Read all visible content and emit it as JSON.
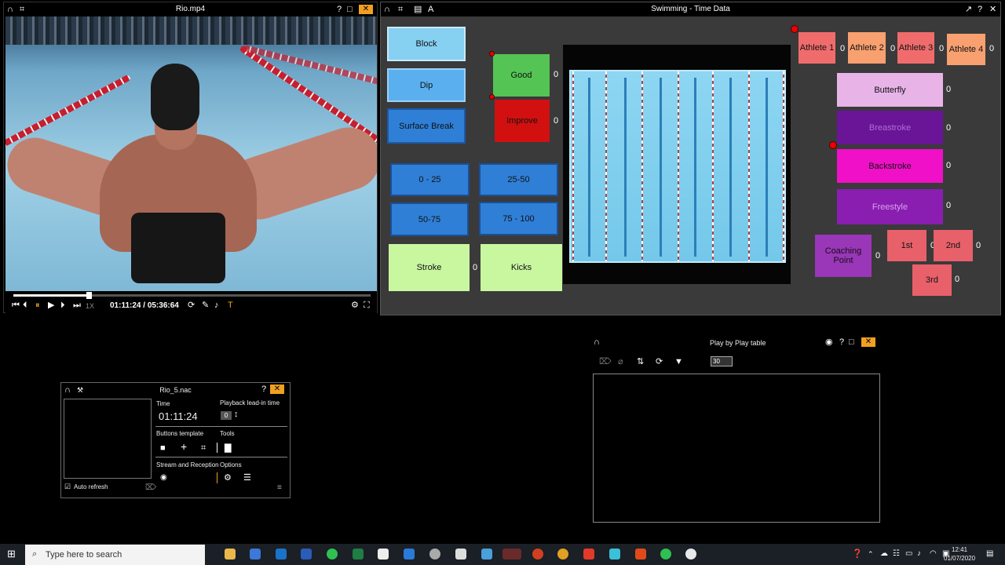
{
  "video_window": {
    "title": "Rio.mp4",
    "time_display": "01:11:24 / 05:36:64",
    "speed": "1X",
    "progress_fraction": 0.21
  },
  "timedata_window": {
    "title": "Swimming - Time Data",
    "start_buttons": [
      {
        "label": "Block",
        "color": "#86d0f2"
      },
      {
        "label": "Dip",
        "color": "#5aafef"
      },
      {
        "label": "Surface Break",
        "color": "#2f7fd6"
      }
    ],
    "quality": [
      {
        "label": "Good",
        "count": "0",
        "color": "#54c454"
      },
      {
        "label": "Improve",
        "count": "0",
        "color": "#d21010"
      }
    ],
    "splits": [
      "0 - 25",
      "25-50",
      "50-75",
      "75 - 100"
    ],
    "stroke": {
      "label": "Stroke",
      "count": "0",
      "color": "#c8f7a0"
    },
    "kicks": {
      "label": "Kicks",
      "color": "#c8f7a0"
    },
    "athletes": [
      {
        "label": "Athlete 1",
        "count": "0",
        "color": "#f06c6c"
      },
      {
        "label": "Athlete 2",
        "count": "0",
        "color": "#f8a070"
      },
      {
        "label": "Athlete 3",
        "count": "0",
        "color": "#f06c6c"
      },
      {
        "label": "Athlete 4",
        "count": "0",
        "color": "#f8a070"
      }
    ],
    "strokes": [
      {
        "label": "Butterfly",
        "count": "0",
        "color": "#e8b4e8"
      },
      {
        "label": "Breastroke",
        "count": "0",
        "color": "#6a1498"
      },
      {
        "label": "Backstroke",
        "count": "0",
        "color": "#f010c8"
      },
      {
        "label": "Freestyle",
        "count": "0",
        "color": "#8a1eb0"
      }
    ],
    "coaching": {
      "label": "Coaching Point",
      "count": "0",
      "color": "#9a36b8"
    },
    "places": [
      {
        "label": "1st",
        "count": "0"
      },
      {
        "label": "2nd",
        "count": "0"
      },
      {
        "label": "3rd",
        "count": "0"
      }
    ]
  },
  "nac_window": {
    "title": "Rio_5.nac",
    "time_label": "Time",
    "time_value": "01:11:24",
    "leadin_label": "Playback lead-in time",
    "leadin_value": "0",
    "buttons_template": "Buttons template",
    "tools": "Tools",
    "stream": "Stream and Reception",
    "options": "Options",
    "auto_refresh": "Auto refresh"
  },
  "pbp_window": {
    "title": "Play by Play table",
    "rows_value": "30"
  },
  "taskbar": {
    "search_placeholder": "Type here to search",
    "time": "12:41",
    "date": "01/07/2020"
  }
}
